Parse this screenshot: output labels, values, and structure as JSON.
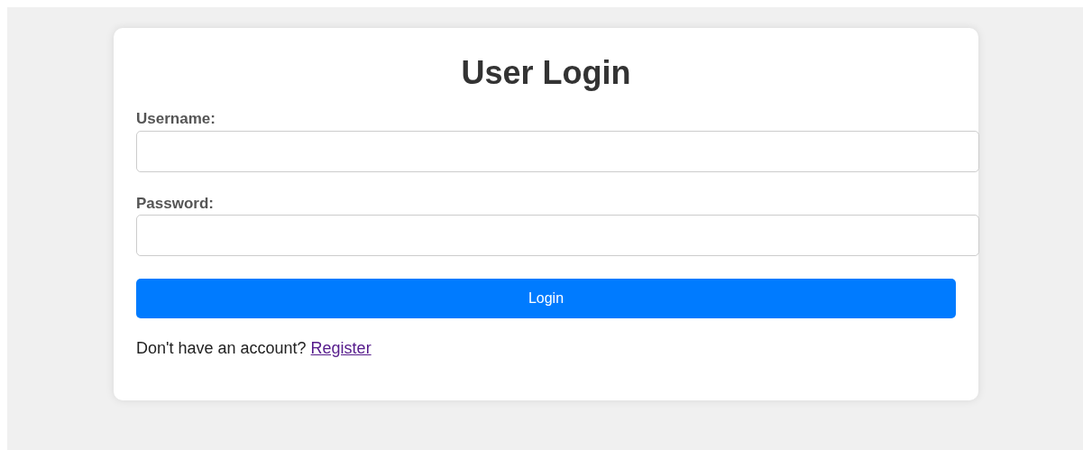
{
  "title": "User Login",
  "fields": [
    {
      "label": "Username:"
    },
    {
      "label": "Password:"
    }
  ],
  "button": "Login",
  "footer": {
    "text": "Don't have an account?",
    "link": "Register",
    "link_visited": true
  }
}
